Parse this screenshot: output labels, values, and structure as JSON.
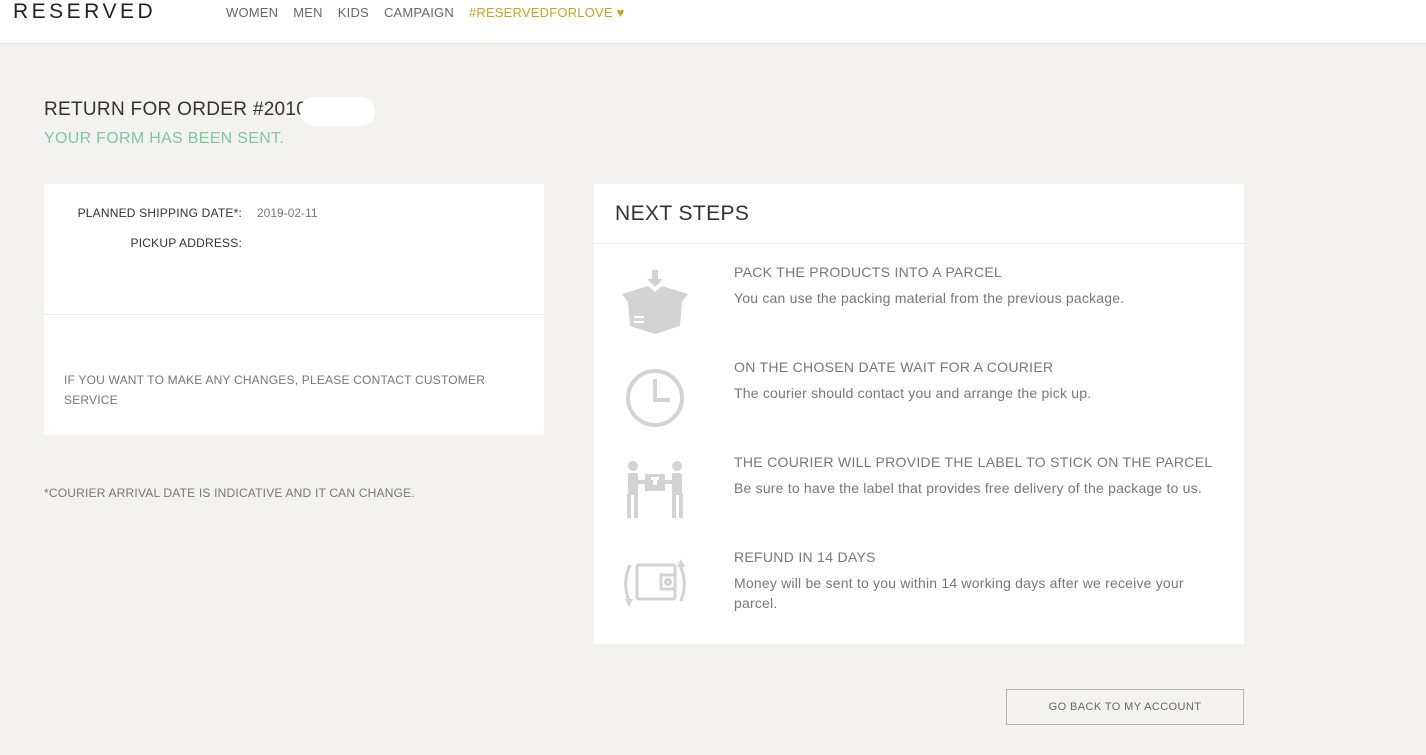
{
  "header": {
    "logo": "RESERVED",
    "nav": [
      "WOMEN",
      "MEN",
      "KIDS",
      "CAMPAIGN"
    ],
    "campaign_love": "#RESERVEDFORLOVE ♥"
  },
  "page": {
    "title": "RETURN FOR ORDER #2010C",
    "status": "YOUR FORM HAS BEEN SENT."
  },
  "details": {
    "shipping_date_label": "PLANNED SHIPPING DATE*:",
    "shipping_date_value": "2019-02-11",
    "pickup_address_label": "PICKUP ADDRESS:",
    "contact_text": "IF YOU WANT TO MAKE ANY CHANGES, PLEASE CONTACT CUSTOMER SERVICE"
  },
  "footnote": "*COURIER ARRIVAL DATE IS INDICATIVE AND IT CAN CHANGE.",
  "next_steps": {
    "heading": "NEXT STEPS",
    "steps": [
      {
        "title": "PACK THE PRODUCTS INTO A PARCEL",
        "desc": " You can use the packing material from the previous package.",
        "icon": "package-icon"
      },
      {
        "title": "ON THE CHOSEN DATE WAIT FOR A COURIER",
        "desc": "The courier should contact you and arrange the pick up.",
        "icon": "clock-icon"
      },
      {
        "title": "THE COURIER WILL PROVIDE THE LABEL TO STICK ON THE PARCEL",
        "desc": "Be sure to have the label that provides free delivery of the package to us.",
        "icon": "courier-handover-icon"
      },
      {
        "title": "REFUND IN 14 DAYS",
        "desc": "Money will be sent to you within 14 working days after we receive your parcel.",
        "icon": "wallet-refund-icon"
      }
    ]
  },
  "actions": {
    "back_label": "GO BACK TO MY ACCOUNT"
  },
  "colors": {
    "accent_gold": "#c9a227",
    "success_green": "#7fc89a",
    "icon_gray": "#d3d3d3"
  }
}
